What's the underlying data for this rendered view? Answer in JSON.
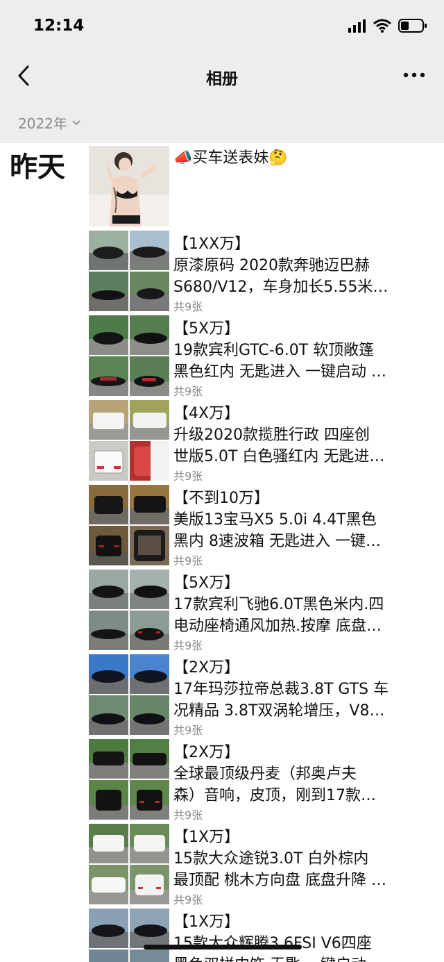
{
  "status": {
    "time": "12:14"
  },
  "nav": {
    "title": "相册"
  },
  "year": {
    "label": "2022年"
  },
  "day": {
    "label": "昨天"
  },
  "posts": [
    {
      "line1": "📣买车送表妹🤔",
      "line2": "",
      "line3": "",
      "count": ""
    },
    {
      "line1": "【1XX万】",
      "line2": "原漆原码 2020款奔驰迈巴赫",
      "line3": "S680/V12，车身加长5.55米…",
      "count": "共9张"
    },
    {
      "line1": "【5X万】",
      "line2": "19款宾利GTC-6.0T 软顶敞篷",
      "line3": "黑色红内 无匙进入 一键启动 …",
      "count": "共9张"
    },
    {
      "line1": "【4X万】",
      "line2": "升级2020款揽胜行政 四座创",
      "line3": "世版5.0T 白色骚红内 无匙进…",
      "count": "共9张"
    },
    {
      "line1": "【不到10万】",
      "line2": "美版13宝马X5 5.0i 4.4T黑色",
      "line3": "黑内 8速波箱 无匙进入 一键…",
      "count": "共9张"
    },
    {
      "line1": "【5X万】",
      "line2": "17款宾利飞驰6.0T黑色米内.四",
      "line3": "电动座椅通风加热.按摩 底盘…",
      "count": "共9张"
    },
    {
      "line1": "【2X万】",
      "line2": "17年玛莎拉帝总裁3.8T GTS 车",
      "line3": "况精品 3.8T双涡轮增压，V8…",
      "count": "共9张"
    },
    {
      "line1": "【2X万】",
      "line2": "全球最顶级丹麦（邦奥卢夫",
      "line3": "森）音响，皮顶，刚到17款…",
      "count": "共9张"
    },
    {
      "line1": "【1X万】",
      "line2": "15款大众途锐3.0T 白外棕内",
      "line3": "最顶配 桃木方向盘 底盘升降 …",
      "count": "共9张"
    },
    {
      "line1": "【1X万】",
      "line2": "15款大众辉腾3.6FSI V6四座",
      "line3": "黑色双拼内饰 无匙 一键启动",
      "count": ""
    }
  ],
  "colors": {
    "bar_bg": "#ededed",
    "muted": "#8a8a8a"
  }
}
